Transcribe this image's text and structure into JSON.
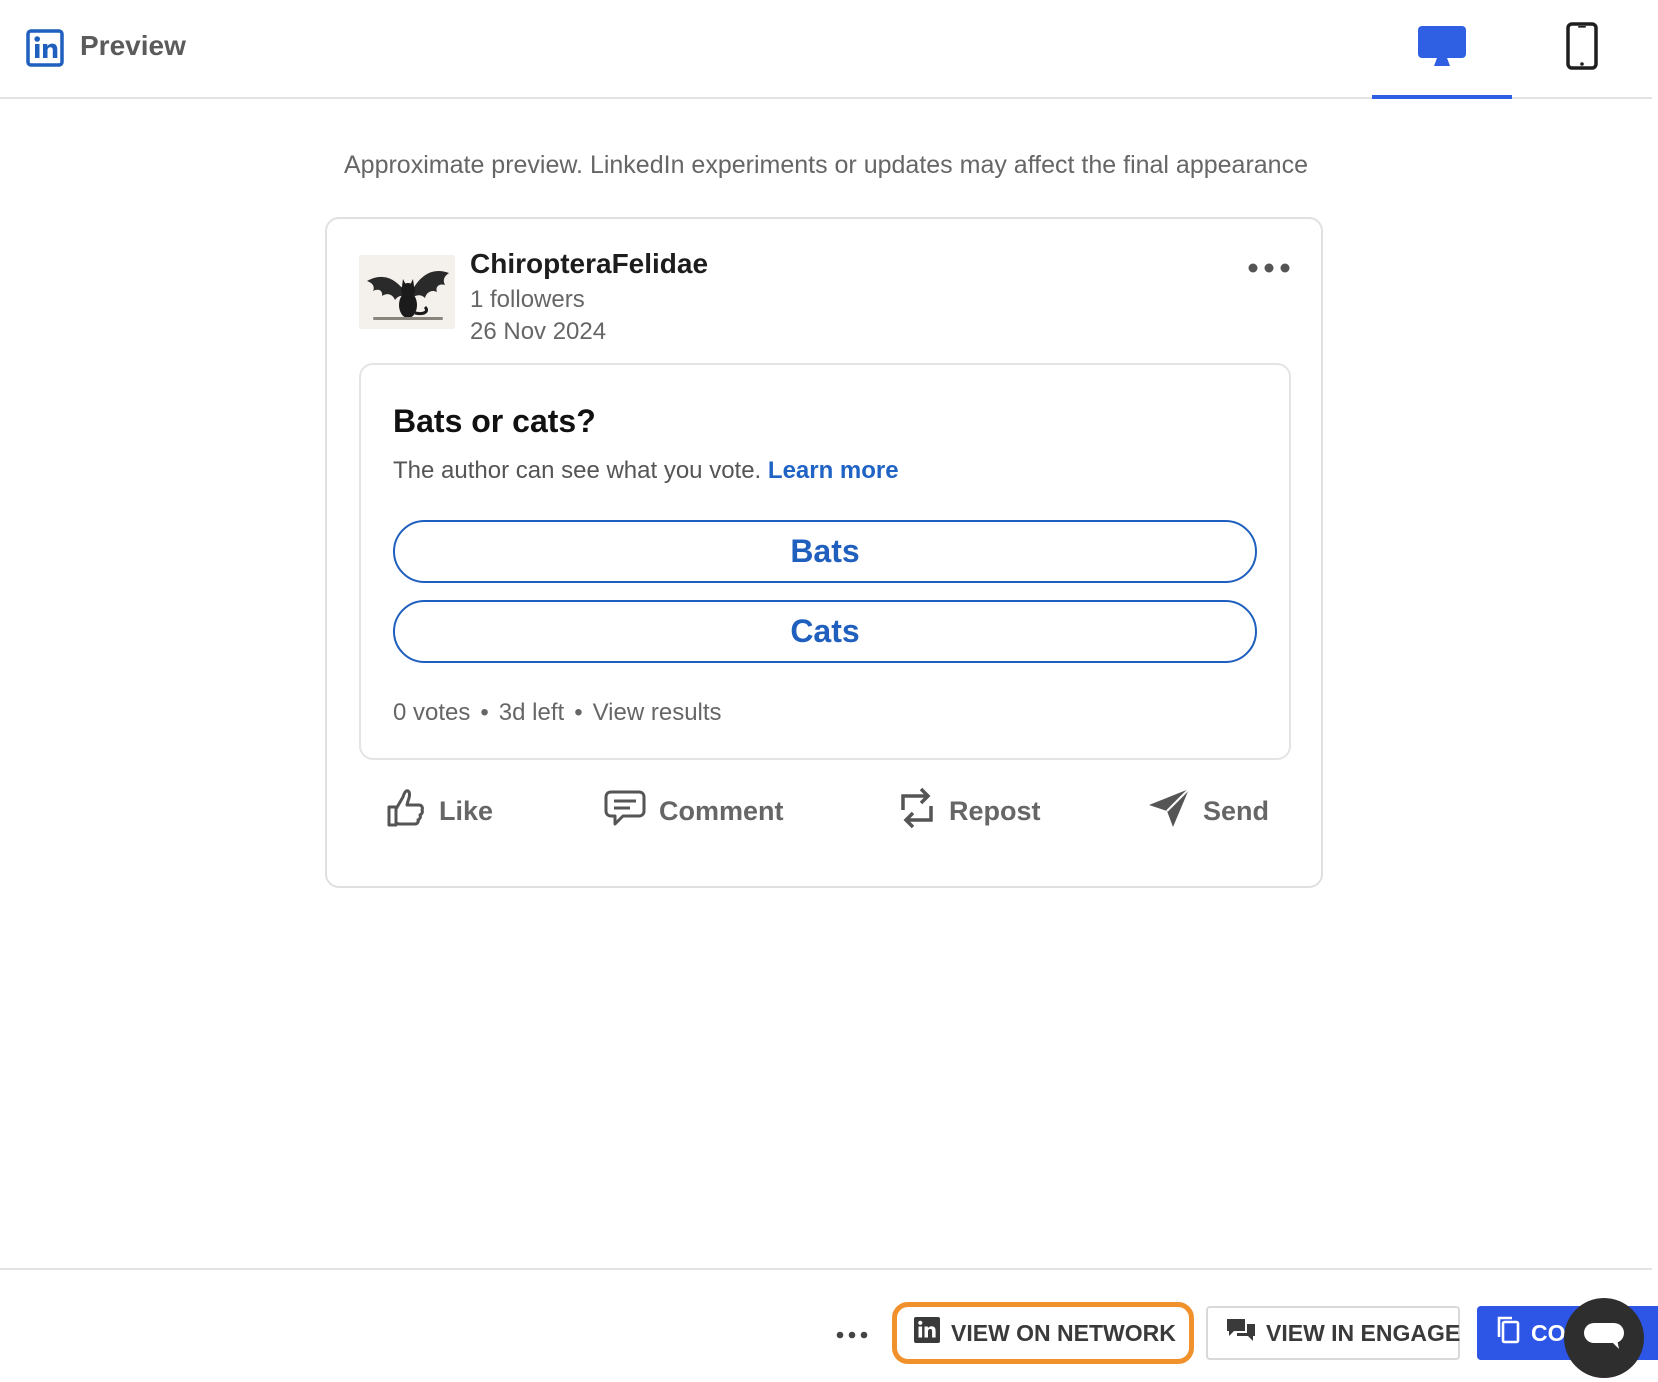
{
  "header": {
    "title": "Preview",
    "logo_icon": "linkedin-icon",
    "tabs": [
      {
        "name": "desktop",
        "icon": "desktop-monitor-icon",
        "active": true
      },
      {
        "name": "mobile",
        "icon": "mobile-phone-icon",
        "active": false
      }
    ],
    "accent": "#2f5fe3"
  },
  "notice": "Approximate preview. LinkedIn experiments or updates may affect the final appearance",
  "post": {
    "author": "ChiropteraFelidae",
    "followers": "1 followers",
    "date": "26 Nov 2024",
    "avatar_icon": "winged-black-cat-avatar",
    "poll": {
      "question": "Bats or cats?",
      "note": "The author can see what you vote.",
      "learn_more": "Learn more",
      "options": [
        "Bats",
        "Cats"
      ],
      "votes": "0 votes",
      "time_left": "3d left",
      "view_results": "View results",
      "separator": "•"
    },
    "actions": {
      "like": "Like",
      "comment": "Comment",
      "repost": "Repost",
      "send": "Send"
    }
  },
  "footer": {
    "view_on_network": "VIEW ON NETWORK",
    "view_in_engage": "VIEW IN ENGAGE",
    "copy": "CO",
    "highlight_color": "#f1912b",
    "primary_color": "#2d55e6"
  }
}
